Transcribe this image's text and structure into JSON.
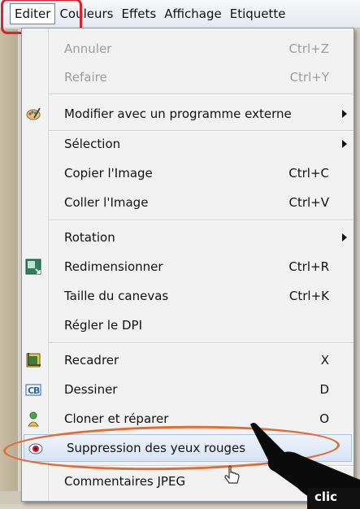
{
  "menubar": {
    "items": [
      "Editer",
      "Couleurs",
      "Effets",
      "Affichage",
      "Etiquette"
    ]
  },
  "menu": {
    "items": [
      {
        "label": "Annuler",
        "shortcut": "Ctrl+Z",
        "enabled": false
      },
      {
        "label": "Refaire",
        "shortcut": "Ctrl+Y",
        "enabled": false
      },
      {
        "label": "Modifier avec un programme externe",
        "submenu": true,
        "icon": "palette-icon"
      },
      {
        "label": "Sélection",
        "submenu": true
      },
      {
        "label": "Copier l'Image",
        "shortcut": "Ctrl+C"
      },
      {
        "label": "Coller l'Image",
        "shortcut": "Ctrl+V"
      },
      {
        "label": "Rotation",
        "submenu": true
      },
      {
        "label": "Redimensionner",
        "shortcut": "Ctrl+R",
        "icon": "resize-icon"
      },
      {
        "label": "Taille du canevas",
        "shortcut": "Ctrl+K"
      },
      {
        "label": "Régler le DPI"
      },
      {
        "label": "Recadrer",
        "shortcut": "X",
        "icon": "crop-icon"
      },
      {
        "label": "Dessiner",
        "shortcut": "D",
        "icon": "draw-icon"
      },
      {
        "label": "Cloner et réparer",
        "shortcut": "O",
        "icon": "clone-icon"
      },
      {
        "label": "Suppression des yeux rouges",
        "icon": "red-eye-icon",
        "highlighted": true
      },
      {
        "label": "Commentaires JPEG"
      }
    ]
  },
  "annotation": {
    "click_label": "clic",
    "highlight_color": "#e26d34",
    "menubar_highlight_color": "#d9232a"
  }
}
